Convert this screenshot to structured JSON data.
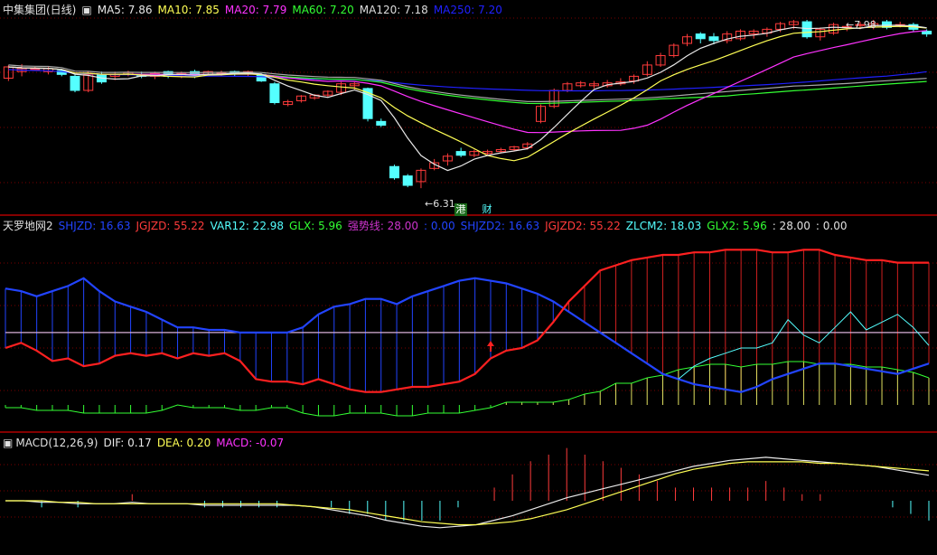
{
  "colors": {
    "up": "#ff3b3b",
    "down": "#54ffff",
    "ma5": "#e8e8e8",
    "ma10": "#ffff55",
    "ma20": "#ff33ff",
    "ma60": "#33ff33",
    "ma120": "#aaaaaa",
    "ma250": "#2020ff",
    "grid": "#7a0000",
    "sep": "#b00000"
  },
  "panel1": {
    "title": "中集集团(日线)",
    "legend": [
      {
        "id": "ma5",
        "text": "MA5: 7.86",
        "color": "#e8e8e8"
      },
      {
        "id": "ma10",
        "text": "MA10: 7.85",
        "color": "#ffff55"
      },
      {
        "id": "ma20",
        "text": "MA20: 7.79",
        "color": "#ff33ff"
      },
      {
        "id": "ma60",
        "text": "MA60: 7.20",
        "color": "#33ff33"
      },
      {
        "id": "ma120",
        "text": "MA120: 7.18",
        "color": "#dddddd"
      },
      {
        "id": "ma250",
        "text": "MA250: 7.20",
        "color": "#2020ff"
      }
    ],
    "low_label": "6.31",
    "high_label": "7.98",
    "tag_gang": "港",
    "tag_cai": "财"
  },
  "panel2": {
    "title": "天罗地网2",
    "legend": [
      {
        "id": "shjzd",
        "text": "SHJZD: 16.63",
        "color": "#2244ff"
      },
      {
        "id": "jgjzd",
        "text": "JGJZD: 55.22",
        "color": "#ff3b3b"
      },
      {
        "id": "var12",
        "text": "VAR12: 22.98",
        "color": "#54ffff"
      },
      {
        "id": "glx",
        "text": "GLX: 5.96",
        "color": "#33ff33"
      },
      {
        "id": "qsx",
        "text": "强势线: 28.00",
        "color": "#cc33cc"
      },
      {
        "id": "zero",
        "text": ": 0.00",
        "color": "#2244ff"
      },
      {
        "id": "shjzd2",
        "text": "SHJZD2: 16.63",
        "color": "#2244ff"
      },
      {
        "id": "jgjzd2",
        "text": "JGJZD2: 55.22",
        "color": "#ff3b3b"
      },
      {
        "id": "zlcm2",
        "text": "ZLCM2: 18.03",
        "color": "#54ffff"
      },
      {
        "id": "glx2",
        "text": "GLX2: 5.96",
        "color": "#33ff33"
      },
      {
        "id": "c28",
        "text": ": 28.00",
        "color": "#e0e0e0"
      },
      {
        "id": "c0",
        "text": ": 0.00",
        "color": "#e0e0e0"
      }
    ]
  },
  "panel3": {
    "title": "MACD(12,26,9)",
    "legend": [
      {
        "id": "dif",
        "text": "DIF: 0.17",
        "color": "#e8e8e8"
      },
      {
        "id": "dea",
        "text": "DEA: 0.20",
        "color": "#ffff55"
      },
      {
        "id": "macd",
        "text": "MACD: -0.07",
        "color": "#ff33ff"
      }
    ]
  },
  "chart_data": [
    {
      "type": "candlestick",
      "title": "中集集团(日线)",
      "ylim": [
        6.1,
        8.1
      ],
      "annotations": [
        {
          "label": "6.31",
          "index": 31,
          "value": 6.31
        },
        {
          "label": "7.98",
          "index": 62,
          "value": 7.98
        }
      ],
      "candles": [
        [
          7.48,
          7.6,
          7.45,
          7.62
        ],
        [
          7.55,
          7.58,
          7.5,
          7.63
        ],
        [
          7.58,
          7.58,
          7.56,
          7.6
        ],
        [
          7.55,
          7.58,
          7.52,
          7.6
        ],
        [
          7.56,
          7.52,
          7.5,
          7.58
        ],
        [
          7.5,
          7.35,
          7.33,
          7.52
        ],
        [
          7.35,
          7.52,
          7.33,
          7.55
        ],
        [
          7.52,
          7.44,
          7.42,
          7.55
        ],
        [
          7.5,
          7.52,
          7.46,
          7.55
        ],
        [
          7.52,
          7.54,
          7.5,
          7.56
        ],
        [
          7.52,
          7.5,
          7.48,
          7.55
        ],
        [
          7.5,
          7.53,
          7.47,
          7.55
        ],
        [
          7.55,
          7.5,
          7.48,
          7.56
        ],
        [
          7.5,
          7.53,
          7.48,
          7.55
        ],
        [
          7.55,
          7.5,
          7.48,
          7.57
        ],
        [
          7.52,
          7.55,
          7.5,
          7.56
        ],
        [
          7.54,
          7.54,
          7.5,
          7.56
        ],
        [
          7.55,
          7.53,
          7.5,
          7.56
        ],
        [
          7.53,
          7.55,
          7.5,
          7.56
        ],
        [
          7.52,
          7.45,
          7.44,
          7.53
        ],
        [
          7.42,
          7.22,
          7.2,
          7.44
        ],
        [
          7.2,
          7.23,
          7.18,
          7.25
        ],
        [
          7.24,
          7.29,
          7.22,
          7.3
        ],
        [
          7.27,
          7.3,
          7.25,
          7.31
        ],
        [
          7.3,
          7.34,
          7.28,
          7.35
        ],
        [
          7.33,
          7.42,
          7.3,
          7.44
        ],
        [
          7.4,
          7.42,
          7.36,
          7.44
        ],
        [
          7.37,
          7.05,
          7.02,
          7.38
        ],
        [
          7.02,
          6.98,
          6.96,
          7.05
        ],
        [
          6.54,
          6.42,
          6.4,
          6.56
        ],
        [
          6.44,
          6.34,
          6.32,
          6.46
        ],
        [
          6.38,
          6.5,
          6.31,
          6.52
        ],
        [
          6.52,
          6.58,
          6.5,
          6.62
        ],
        [
          6.6,
          6.65,
          6.55,
          6.68
        ],
        [
          6.7,
          6.66,
          6.64,
          6.74
        ],
        [
          6.66,
          6.7,
          6.64,
          6.72
        ],
        [
          6.68,
          6.7,
          6.66,
          6.72
        ],
        [
          6.7,
          6.72,
          6.68,
          6.74
        ],
        [
          6.72,
          6.75,
          6.7,
          6.76
        ],
        [
          6.74,
          6.78,
          6.72,
          6.8
        ],
        [
          7.02,
          7.18,
          7.0,
          7.2
        ],
        [
          7.18,
          7.35,
          7.16,
          7.37
        ],
        [
          7.35,
          7.42,
          7.33,
          7.44
        ],
        [
          7.4,
          7.43,
          7.38,
          7.45
        ],
        [
          7.4,
          7.42,
          7.37,
          7.45
        ],
        [
          7.4,
          7.43,
          7.38,
          7.46
        ],
        [
          7.42,
          7.44,
          7.4,
          7.48
        ],
        [
          7.45,
          7.5,
          7.42,
          7.52
        ],
        [
          7.52,
          7.62,
          7.5,
          7.66
        ],
        [
          7.62,
          7.72,
          7.6,
          7.75
        ],
        [
          7.72,
          7.83,
          7.7,
          7.85
        ],
        [
          7.85,
          7.92,
          7.82,
          7.95
        ],
        [
          7.95,
          7.9,
          7.85,
          7.97
        ],
        [
          7.92,
          7.88,
          7.84,
          7.96
        ],
        [
          7.88,
          7.95,
          7.85,
          7.98
        ],
        [
          7.9,
          7.98,
          7.88,
          8.0
        ],
        [
          7.95,
          7.98,
          7.9,
          8.0
        ],
        [
          7.96,
          8.0,
          7.92,
          8.02
        ],
        [
          8.0,
          8.06,
          7.97,
          8.08
        ],
        [
          8.05,
          8.08,
          8.0,
          8.1
        ],
        [
          8.08,
          7.92,
          7.9,
          8.1
        ],
        [
          7.92,
          8.0,
          7.88,
          8.02
        ],
        [
          7.96,
          8.05,
          7.94,
          8.07
        ],
        [
          8.02,
          8.03,
          7.98,
          8.06
        ],
        [
          8.05,
          8.05,
          8.0,
          8.08
        ],
        [
          8.04,
          8.06,
          8.0,
          8.1
        ],
        [
          8.08,
          8.02,
          8.0,
          8.1
        ],
        [
          8.05,
          8.05,
          8.02,
          8.08
        ],
        [
          8.05,
          8.0,
          7.98,
          8.07
        ],
        [
          7.98,
          7.95,
          7.92,
          8.0
        ]
      ]
    },
    {
      "type": "line",
      "title": "天罗地网2",
      "ylim": [
        0,
        65
      ],
      "series": [
        {
          "name": "SHJZD",
          "values": [
            45,
            44,
            42,
            44,
            46,
            49,
            44,
            40,
            38,
            36,
            33,
            30,
            30,
            29,
            29,
            28,
            28,
            28,
            28,
            30,
            35,
            38,
            39,
            41,
            41,
            39,
            42,
            44,
            46,
            48,
            49,
            48,
            47,
            45,
            43,
            40,
            36,
            32,
            28,
            24,
            20,
            16,
            12,
            10,
            8,
            7,
            6,
            5,
            7,
            10,
            12,
            14,
            16,
            16,
            15,
            14,
            13,
            12,
            14,
            16
          ]
        },
        {
          "name": "JGJZD",
          "values": [
            22,
            24,
            21,
            17,
            18,
            15,
            16,
            19,
            20,
            19,
            20,
            18,
            20,
            19,
            20,
            17,
            10,
            9,
            9,
            8,
            10,
            8,
            6,
            5,
            5,
            6,
            7,
            7,
            8,
            9,
            12,
            18,
            21,
            22,
            25,
            32,
            40,
            46,
            52,
            54,
            56,
            57,
            58,
            58,
            59,
            59,
            60,
            60,
            60,
            59,
            59,
            60,
            60,
            58,
            57,
            56,
            56,
            55,
            55,
            55
          ]
        },
        {
          "name": "VAR12",
          "values": [
            null,
            null,
            null,
            null,
            null,
            null,
            null,
            null,
            null,
            null,
            null,
            null,
            null,
            null,
            null,
            null,
            null,
            null,
            null,
            null,
            null,
            null,
            null,
            null,
            null,
            null,
            null,
            null,
            null,
            null,
            null,
            null,
            null,
            null,
            null,
            null,
            null,
            null,
            null,
            null,
            null,
            null,
            null,
            10,
            15,
            18,
            20,
            22,
            22,
            24,
            33,
            27,
            24,
            30,
            36,
            29,
            32,
            35,
            30,
            23
          ]
        },
        {
          "name": "GLX",
          "values": [
            -1,
            -1,
            -2,
            -2,
            -2,
            -3,
            -3,
            -3,
            -3,
            -3,
            -2,
            0,
            -1,
            -1,
            -1,
            -2,
            -2,
            -1,
            -1,
            -3,
            -4,
            -4,
            -3,
            -3,
            -3,
            -4,
            -4,
            -3,
            -3,
            -3,
            -2,
            -1,
            1,
            1,
            1,
            1,
            2,
            4,
            5,
            8,
            8,
            10,
            11,
            13,
            14,
            15,
            15,
            14,
            15,
            15,
            16,
            16,
            15,
            15,
            15,
            14,
            14,
            13,
            12,
            10
          ]
        }
      ]
    },
    {
      "type": "line",
      "title": "MACD(12,26,9)",
      "ylim": [
        -0.35,
        0.35
      ],
      "series": [
        {
          "name": "DIF",
          "values": [
            0.0,
            0.0,
            -0.01,
            -0.01,
            -0.02,
            -0.02,
            -0.02,
            -0.01,
            -0.02,
            -0.02,
            -0.02,
            -0.03,
            -0.03,
            -0.03,
            -0.03,
            -0.03,
            -0.03,
            -0.04,
            -0.06,
            -0.08,
            -0.1,
            -0.13,
            -0.15,
            -0.17,
            -0.18,
            -0.17,
            -0.16,
            -0.13,
            -0.1,
            -0.06,
            -0.02,
            0.02,
            0.05,
            0.08,
            0.11,
            0.14,
            0.17,
            0.2,
            0.23,
            0.25,
            0.27,
            0.28,
            0.29,
            0.28,
            0.27,
            0.26,
            0.25,
            0.24,
            0.23,
            0.21,
            0.19,
            0.17
          ]
        },
        {
          "name": "DEA",
          "values": [
            0.0,
            0.0,
            0.0,
            -0.01,
            -0.01,
            -0.02,
            -0.02,
            -0.02,
            -0.02,
            -0.02,
            -0.02,
            -0.02,
            -0.02,
            -0.02,
            -0.02,
            -0.02,
            -0.03,
            -0.04,
            -0.05,
            -0.06,
            -0.08,
            -0.1,
            -0.12,
            -0.14,
            -0.15,
            -0.16,
            -0.16,
            -0.15,
            -0.14,
            -0.12,
            -0.09,
            -0.06,
            -0.02,
            0.02,
            0.06,
            0.1,
            0.14,
            0.18,
            0.21,
            0.23,
            0.25,
            0.26,
            0.26,
            0.26,
            0.26,
            0.25,
            0.25,
            0.24,
            0.23,
            0.22,
            0.21,
            0.2
          ]
        }
      ]
    }
  ]
}
